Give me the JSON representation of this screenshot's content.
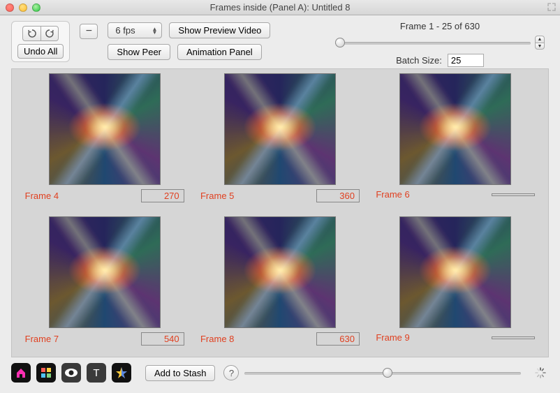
{
  "window": {
    "title": "Frames inside (Panel A): Untitled 8"
  },
  "toolbar": {
    "undo_all_label": "Undo All",
    "fps_label": "6 fps",
    "show_preview_label": "Show Preview Video",
    "show_peer_label": "Show Peer",
    "animation_panel_label": "Animation Panel"
  },
  "range": {
    "text": "Frame 1 - 25 of 630",
    "batch_label": "Batch Size:",
    "batch_value": "25"
  },
  "frames": [
    {
      "label": "Frame  4",
      "value": "270"
    },
    {
      "label": "Frame  5",
      "value": "360"
    },
    {
      "label": "Frame  6",
      "value": ""
    },
    {
      "label": "Frame  7",
      "value": "540"
    },
    {
      "label": "Frame  8",
      "value": "630"
    },
    {
      "label": "Frame  9",
      "value": ""
    }
  ],
  "bottom": {
    "add_to_stash_label": "Add to Stash",
    "help_label": "?"
  }
}
